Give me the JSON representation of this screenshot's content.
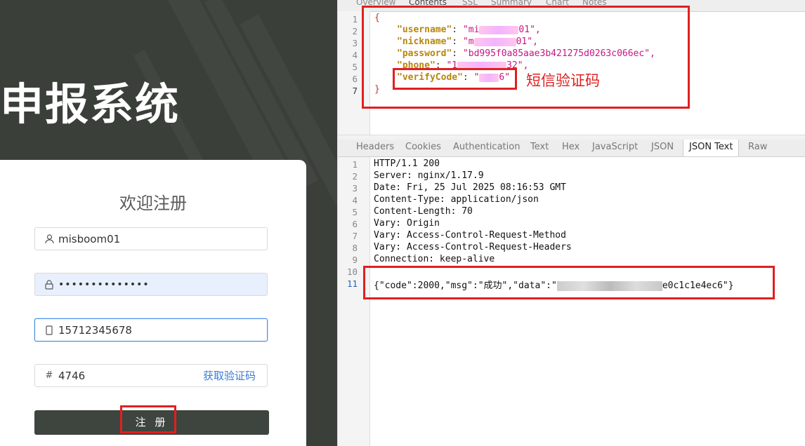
{
  "left": {
    "system_title": "申报系统",
    "card_title": "欢迎注册",
    "fields": {
      "username": "misboom01",
      "password_masked": "••••••••••••••",
      "phone": "15712345678",
      "code": "4746",
      "sms_link": "获取验证码"
    },
    "submit_label": "注 册"
  },
  "right": {
    "top_tabs": [
      "Overview",
      "Contents",
      "SSL",
      "Summary",
      "Chart",
      "Notes"
    ],
    "request_lines": [
      "1",
      "2",
      "3",
      "4",
      "5",
      "6",
      "7"
    ],
    "request": {
      "open_brace": "{",
      "close_brace": "}",
      "username_key": "\"username\"",
      "username_prefix": "\"mi",
      "username_suffix": "01\",",
      "nickname_key": "\"nickname\"",
      "nickname_prefix": "\"m",
      "nickname_suffix": "01\",",
      "password_key": "\"password\"",
      "password_value": "\"bd995f0a85aae3b421275d0263c066ec\",",
      "phone_key": "\"phone\"",
      "phone_prefix": "\"1",
      "phone_suffix": "32\",",
      "verify_key": "\"verifyCode\"",
      "verify_prefix": "\"",
      "verify_suffix": "6\""
    },
    "annotation": "短信验证码",
    "mid_tabs": [
      "Headers",
      "Cookies",
      "Authentication",
      "Text",
      "Hex",
      "JavaScript",
      "JSON",
      "JSON Text",
      "Raw"
    ],
    "active_mid_tab": "JSON Text",
    "response_lines": [
      "1",
      "2",
      "3",
      "4",
      "5",
      "6",
      "7",
      "8",
      "9",
      "10",
      "11"
    ],
    "response": {
      "l1": "HTTP/1.1 200",
      "l2": "Server: nginx/1.17.9",
      "l3": "Date: Fri, 25 Jul 2025 08:16:53 GMT",
      "l4": "Content-Type: application/json",
      "l5": "Content-Length: 70",
      "l6": "Vary: Origin",
      "l7": "Vary: Access-Control-Request-Method",
      "l8": "Vary: Access-Control-Request-Headers",
      "l9": "Connection: keep-alive",
      "l11_prefix": "{\"code\":2000,\"msg\":\"成功\",\"data\":\"",
      "l11_suffix": "e0c1c1e4ec6\"}"
    }
  }
}
